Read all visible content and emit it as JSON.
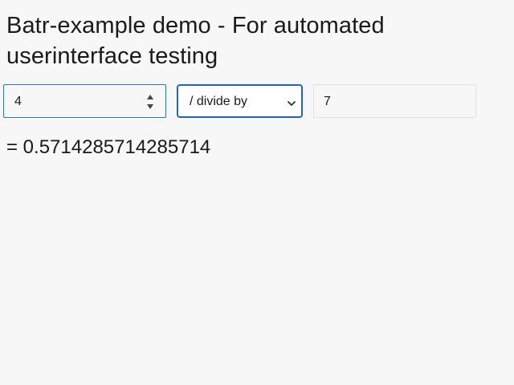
{
  "heading": "Batr-example demo - For automated userinterface testing",
  "calculator": {
    "operand_a": "4",
    "operator": "/ divide by",
    "operand_b": "7",
    "result": "= 0.5714285714285714"
  },
  "icons": {
    "step_up": "triangle-up-icon",
    "step_down": "triangle-down-icon",
    "select": "chevron-down-icon"
  },
  "colors": {
    "background": "#f7f7f7",
    "focus_border": "#2463c4",
    "input_border": "#e0e0e0"
  }
}
